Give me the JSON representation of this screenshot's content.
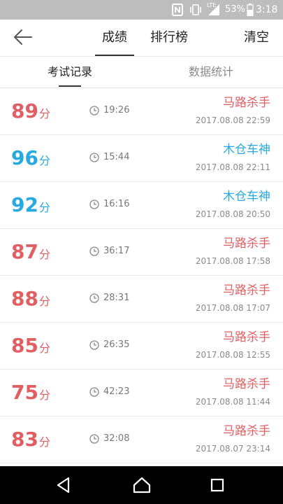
{
  "status_bar": {
    "battery": "53%",
    "time": "3:18",
    "network": "LTE"
  },
  "header": {
    "tabs": [
      {
        "label": "成绩"
      },
      {
        "label": "排行榜"
      }
    ],
    "clear_label": "清空"
  },
  "subtabs": [
    {
      "label": "考试记录"
    },
    {
      "label": "数据统计"
    }
  ],
  "colors": {
    "red": "#e05f63",
    "blue": "#27a9e1"
  },
  "records": [
    {
      "score": "89",
      "unit": "分",
      "duration": "19:26",
      "user": "马路杀手",
      "date": "2017.08.08  22:59",
      "color": "red"
    },
    {
      "score": "96",
      "unit": "分",
      "duration": "15:44",
      "user": "木仓车神",
      "date": "2017.08.08  22:11",
      "color": "blue"
    },
    {
      "score": "92",
      "unit": "分",
      "duration": "16:16",
      "user": "木仓车神",
      "date": "2017.08.08  20:50",
      "color": "blue"
    },
    {
      "score": "87",
      "unit": "分",
      "duration": "36:17",
      "user": "马路杀手",
      "date": "2017.08.08  17:58",
      "color": "red"
    },
    {
      "score": "88",
      "unit": "分",
      "duration": "28:31",
      "user": "马路杀手",
      "date": "2017.08.08  17:07",
      "color": "red"
    },
    {
      "score": "85",
      "unit": "分",
      "duration": "26:35",
      "user": "马路杀手",
      "date": "2017.08.08  12:55",
      "color": "red"
    },
    {
      "score": "75",
      "unit": "分",
      "duration": "42:23",
      "user": "马路杀手",
      "date": "2017.08.08  11:44",
      "color": "red"
    },
    {
      "score": "83",
      "unit": "分",
      "duration": "32:08",
      "user": "马路杀手",
      "date": "2017.08.07  23:14",
      "color": "red"
    }
  ]
}
